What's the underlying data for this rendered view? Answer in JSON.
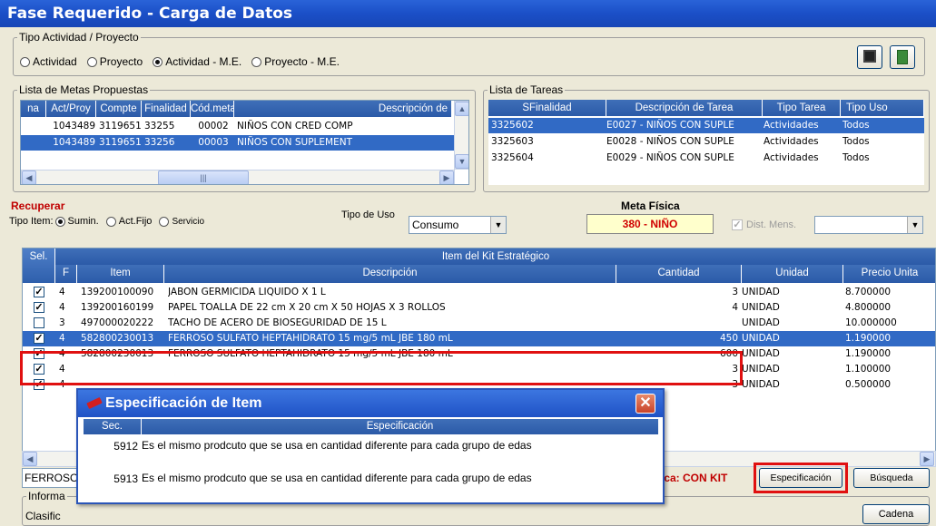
{
  "window": {
    "title": "Fase Requerido - Carga de Datos"
  },
  "tipo_actividad": {
    "legend": "Tipo Actividad / Proyecto",
    "options": [
      "Actividad",
      "Proyecto",
      "Actividad - M.E.",
      "Proyecto - M.E."
    ],
    "selected": 2
  },
  "metas": {
    "legend": "Lista de Metas Propuestas",
    "headers": [
      "na",
      "Act/Proy",
      "Compte",
      "Finalidad",
      "Cód.meta",
      "Descripción de"
    ],
    "rows": [
      [
        "",
        "1043489",
        "3119651",
        "33255",
        "00002",
        "NIÑOS CON CRED COMP"
      ],
      [
        "",
        "1043489",
        "3119651",
        "33256",
        "00003",
        "NIÑOS CON SUPLEMENT"
      ]
    ]
  },
  "tareas": {
    "legend": "Lista de Tareas",
    "headers": [
      "SFinalidad",
      "Descripción de Tarea",
      "Tipo Tarea",
      "Tipo Uso"
    ],
    "rows": [
      [
        "3325602",
        "E0027 - NIÑOS CON SUPLE",
        "Actividades",
        "Todos"
      ],
      [
        "3325603",
        "E0028 - NIÑOS CON SUPLE",
        "Actividades",
        "Todos"
      ],
      [
        "3325604",
        "E0029 - NIÑOS CON SUPLE",
        "Actividades",
        "Todos"
      ]
    ]
  },
  "recuperar": {
    "legend": "Recuperar",
    "tipo_item_label": "Tipo Item:",
    "options": [
      "Sumin.",
      "Act.Fijo",
      "Servicio"
    ],
    "tipo_uso_label": "Tipo de Uso",
    "tipo_uso_value": "Consumo"
  },
  "meta_fisica": {
    "label": "Meta Física",
    "value": "380 - NIÑO"
  },
  "dist_mens": {
    "label": "Dist. Mens."
  },
  "items": {
    "group_header": "Item del Kit Estratégico",
    "headers": [
      "Sel.",
      "F",
      "Item",
      "Descripción",
      "Cantidad",
      "Unidad",
      "Precio Unita"
    ],
    "rows": [
      {
        "f": "4",
        "item": "139200100090",
        "desc": "JABON GERMICIDA LIQUIDO X 1 L",
        "cant": "3",
        "unidad": "UNIDAD",
        "precio": "8.700000"
      },
      {
        "f": "4",
        "item": "139200160199",
        "desc": "PAPEL TOALLA DE 22 cm X 20 cm X 50 HOJAS X 3 ROLLOS",
        "cant": "4",
        "unidad": "UNIDAD",
        "precio": "4.800000"
      },
      {
        "f": "3",
        "item": "497000020222",
        "desc": "TACHO DE ACERO DE BIOSEGURIDAD DE 15 L",
        "cant": "",
        "unidad": "UNIDAD",
        "precio": "10.000000"
      },
      {
        "f": "4",
        "item": "582800230013",
        "desc": "FERROSO SULFATO HEPTAHIDRATO 15 mg/5 mL JBE 180 mL",
        "cant": "450",
        "unidad": "UNIDAD",
        "precio": "1.190000"
      },
      {
        "f": "4",
        "item": "582800230013",
        "desc": "FERROSO SULFATO HEPTAHIDRATO 15 mg/5 mL JBE 180 mL",
        "cant": "600",
        "unidad": "UNIDAD",
        "precio": "1.190000"
      },
      {
        "f": "4",
        "item": "",
        "desc": "",
        "cant": "3",
        "unidad": "UNIDAD",
        "precio": "1.100000"
      },
      {
        "f": "4",
        "item": "",
        "desc": "",
        "cant": "3",
        "unidad": "UNIDAD",
        "precio": "0.500000"
      }
    ]
  },
  "bottom": {
    "ferroso": "FERROSO",
    "informa": "Informa",
    "clasific": "Clasific",
    "con_kit": "ica: CON KIT",
    "especificacion_btn": "Especificación",
    "busqueda_btn": "Búsqueda",
    "cadena_btn": "Cadena"
  },
  "popup": {
    "title": "Especificación de Item",
    "headers": [
      "Sec.",
      "Especificación"
    ],
    "rows": [
      [
        "5912",
        "Es el mismo prodcuto que se usa en cantidad diferente para cada grupo de edas"
      ],
      [
        "5913",
        "Es el mismo prodcuto que se usa en cantidad diferente para cada grupo de edas"
      ]
    ]
  },
  "colors": {
    "selection": "#316ac5",
    "highlight_box": "#e01010",
    "title_bar": "#1b4fc7"
  }
}
